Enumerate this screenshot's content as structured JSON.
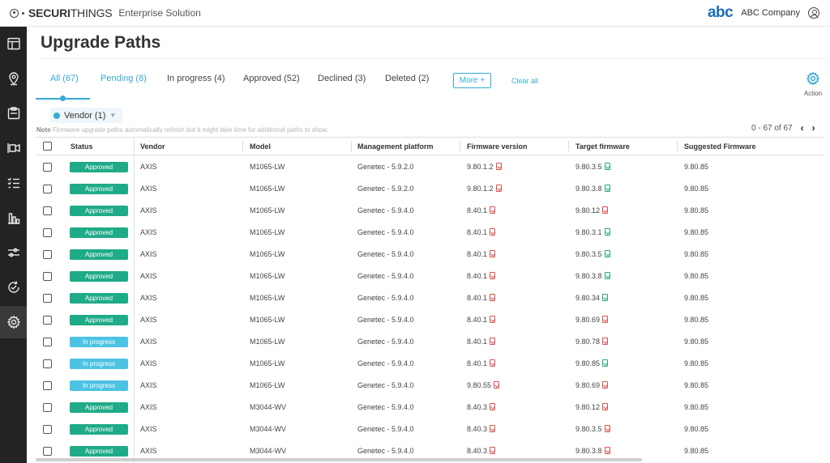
{
  "header": {
    "brand_bold": "SECURI",
    "brand_thin": "THINGS",
    "brand_sub": "Enterprise Solution",
    "client_logo": "abc",
    "company": "ABC Company",
    "user_icon": "user-circle-icon"
  },
  "sidebar": {
    "items": [
      {
        "icon": "dashboard-icon",
        "active": false
      },
      {
        "icon": "location-pin-icon",
        "active": false
      },
      {
        "icon": "clipboard-icon",
        "active": false
      },
      {
        "icon": "camera-icon",
        "active": false
      },
      {
        "icon": "checklist-icon",
        "active": false
      },
      {
        "icon": "bar-chart-icon",
        "active": false
      },
      {
        "icon": "sliders-icon",
        "active": false
      },
      {
        "icon": "refresh-check-icon",
        "active": false
      },
      {
        "icon": "gear-icon",
        "active": true
      }
    ]
  },
  "page": {
    "title": "Upgrade Paths"
  },
  "tabs": [
    {
      "label": "All (67)",
      "active": true
    },
    {
      "label": "Pending (8)",
      "active": false
    },
    {
      "label": "In progress (4)",
      "active": false
    },
    {
      "label": "Approved (52)",
      "active": false
    },
    {
      "label": "Declined (3)",
      "active": false
    },
    {
      "label": "Deleted (2)",
      "active": false
    }
  ],
  "toolbar": {
    "more_label": "More +",
    "clear_all_label": "Clear all",
    "action_label": "Action"
  },
  "filter": {
    "chip_label": "Vendor (1)"
  },
  "note": {
    "prefix": "Note",
    "text": "Firmware upgrade paths automatically refresh but it might take time for additional paths to show."
  },
  "pagination": {
    "range": "0 - 67 of 67",
    "prev": "‹",
    "next": "›"
  },
  "table": {
    "columns": [
      "Status",
      "Vendor",
      "Model",
      "Management platform",
      "Firmware version",
      "Target firmware",
      "Suggested Firmware"
    ],
    "rows": [
      {
        "status": "Approved",
        "status_type": "approved",
        "vendor": "AXIS",
        "model": "M1065-LW",
        "platform": "Genetec - 5.9.2.0",
        "firmware": "9.80.1.2",
        "fw_icon": "red",
        "target": "9.80.3.5",
        "target_icon": "green",
        "suggested": "9.80.85"
      },
      {
        "status": "Approved",
        "status_type": "approved",
        "vendor": "AXIS",
        "model": "M1065-LW",
        "platform": "Genetec - 5.9.2.0",
        "firmware": "9.80.1.2",
        "fw_icon": "red",
        "target": "9.80.3.8",
        "target_icon": "green",
        "suggested": "9.80.85"
      },
      {
        "status": "Approved",
        "status_type": "approved",
        "vendor": "AXIS",
        "model": "M1065-LW",
        "platform": "Genetec - 5.9.4.0",
        "firmware": "8.40.1",
        "fw_icon": "red",
        "target": "9.80.12",
        "target_icon": "red",
        "suggested": "9.80.85"
      },
      {
        "status": "Approved",
        "status_type": "approved",
        "vendor": "AXIS",
        "model": "M1065-LW",
        "platform": "Genetec - 5.9.4.0",
        "firmware": "8.40.1",
        "fw_icon": "red",
        "target": "9.80.3.1",
        "target_icon": "green",
        "suggested": "9.80.85"
      },
      {
        "status": "Approved",
        "status_type": "approved",
        "vendor": "AXIS",
        "model": "M1065-LW",
        "platform": "Genetec - 5.9.4.0",
        "firmware": "8.40.1",
        "fw_icon": "red",
        "target": "9.80.3.5",
        "target_icon": "green",
        "suggested": "9.80.85"
      },
      {
        "status": "Approved",
        "status_type": "approved",
        "vendor": "AXIS",
        "model": "M1065-LW",
        "platform": "Genetec - 5.9.4.0",
        "firmware": "8.40.1",
        "fw_icon": "red",
        "target": "9.80.3.8",
        "target_icon": "green",
        "suggested": "9.80.85"
      },
      {
        "status": "Approved",
        "status_type": "approved",
        "vendor": "AXIS",
        "model": "M1065-LW",
        "platform": "Genetec - 5.9.4.0",
        "firmware": "8.40.1",
        "fw_icon": "red",
        "target": "9.80.34",
        "target_icon": "green",
        "suggested": "9.80.85"
      },
      {
        "status": "Approved",
        "status_type": "approved",
        "vendor": "AXIS",
        "model": "M1065-LW",
        "platform": "Genetec - 5.9.4.0",
        "firmware": "8.40.1",
        "fw_icon": "red",
        "target": "9.80.69",
        "target_icon": "red",
        "suggested": "9.80.85"
      },
      {
        "status": "In progress",
        "status_type": "inprogress",
        "vendor": "AXIS",
        "model": "M1065-LW",
        "platform": "Genetec - 5.9.4.0",
        "firmware": "8.40.1",
        "fw_icon": "red",
        "target": "9.80.78",
        "target_icon": "red",
        "suggested": "9.80.85"
      },
      {
        "status": "In progress",
        "status_type": "inprogress",
        "vendor": "AXIS",
        "model": "M1065-LW",
        "platform": "Genetec - 5.9.4.0",
        "firmware": "8.40.1",
        "fw_icon": "red",
        "target": "9.80.85",
        "target_icon": "green",
        "suggested": "9.80.85"
      },
      {
        "status": "In progress",
        "status_type": "inprogress",
        "vendor": "AXIS",
        "model": "M1065-LW",
        "platform": "Genetec - 5.9.4.0",
        "firmware": "9.80.55",
        "fw_icon": "red",
        "target": "9.80.69",
        "target_icon": "red",
        "suggested": "9.80.85"
      },
      {
        "status": "Approved",
        "status_type": "approved",
        "vendor": "AXIS",
        "model": "M3044-WV",
        "platform": "Genetec - 5.9.4.0",
        "firmware": "8.40.3",
        "fw_icon": "red",
        "target": "9.80.12",
        "target_icon": "red",
        "suggested": "9.80.85"
      },
      {
        "status": "Approved",
        "status_type": "approved",
        "vendor": "AXIS",
        "model": "M3044-WV",
        "platform": "Genetec - 5.9.4.0",
        "firmware": "8.40.3",
        "fw_icon": "red",
        "target": "9.80.3.5",
        "target_icon": "red",
        "suggested": "9.80.85"
      },
      {
        "status": "Approved",
        "status_type": "approved",
        "vendor": "AXIS",
        "model": "M3044-WV",
        "platform": "Genetec - 5.9.4.0",
        "firmware": "8.40.3",
        "fw_icon": "red",
        "target": "9.80.3.8",
        "target_icon": "red",
        "suggested": "9.80.85"
      }
    ]
  },
  "colors": {
    "accent": "#39a9d6",
    "approved": "#1fab87",
    "in_progress": "#4cc3e3",
    "sidebar_bg": "#232323",
    "brand_blue": "#1b6fb3"
  }
}
